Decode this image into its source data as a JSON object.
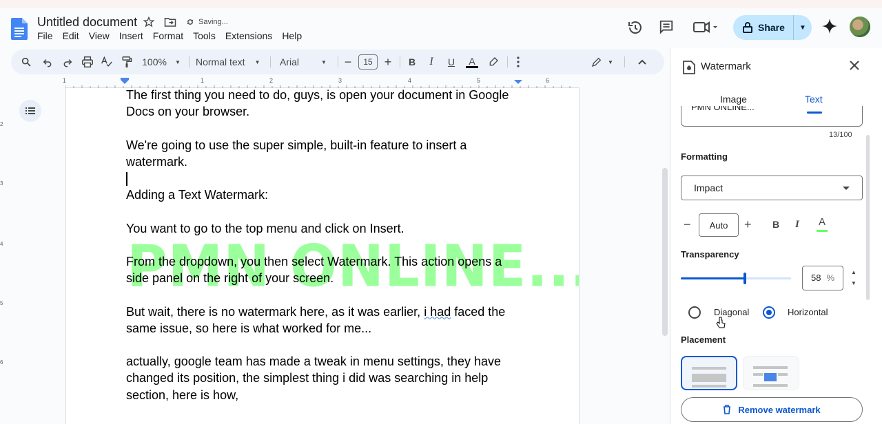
{
  "header": {
    "doc_title": "Untitled document",
    "saving_status": "Saving...",
    "menu": [
      "File",
      "Edit",
      "View",
      "Insert",
      "Format",
      "Tools",
      "Extensions",
      "Help"
    ],
    "share_label": "Share"
  },
  "toolbar": {
    "zoom": "100%",
    "style": "Normal text",
    "font": "Arial",
    "font_size": "15"
  },
  "ruler": {
    "marks": [
      "1",
      "1",
      "2",
      "3",
      "4",
      "5",
      "6",
      "7"
    ],
    "vmarks": [
      "2",
      "3",
      "4",
      "5",
      "6"
    ]
  },
  "document": {
    "line1": "The first thing you need to do, guys, is open your document in Google",
    "line2": "Docs on your browser.",
    "line3": "We're going to use the super simple, built-in feature to insert a",
    "line4": "watermark.",
    "line5": "Adding a Text Watermark:",
    "line6": "You want to go to the top menu and click on Insert.",
    "line7": "From the dropdown, you then select Watermark. This action opens a",
    "line8": "side panel on the right of your screen.",
    "line9_a": "But wait, there is no watermark here, as it was earlier, ",
    "line9_b": "i had",
    "line9_c": " faced the",
    "line10": "same issue, so here is what worked for me...",
    "line11": "actually, google team has made a tweak in menu settings, they have",
    "line12": "changed its position, the simplest thing i did was searching in help",
    "line13": "section, here is how,",
    "watermark": "PMN ONLINE..."
  },
  "panel": {
    "title": "Watermark",
    "tabs": [
      "Image",
      "Text"
    ],
    "active_tab": "Text",
    "text_value": "PMN ONLINE...",
    "char_count": "13/100",
    "formatting_label": "Formatting",
    "font_value": "Impact",
    "size_value": "Auto",
    "bold": "B",
    "italic": "I",
    "color_letter": "A",
    "transparency_label": "Transparency",
    "transparency_value": "58",
    "transparency_unit": "%",
    "transparency_level": 0.58,
    "orientation_options": [
      "Diagonal",
      "Horizontal"
    ],
    "orientation_selected": "Horizontal",
    "placement_label": "Placement",
    "remove_label": "Remove watermark",
    "watermark_color": "#66ff66"
  }
}
